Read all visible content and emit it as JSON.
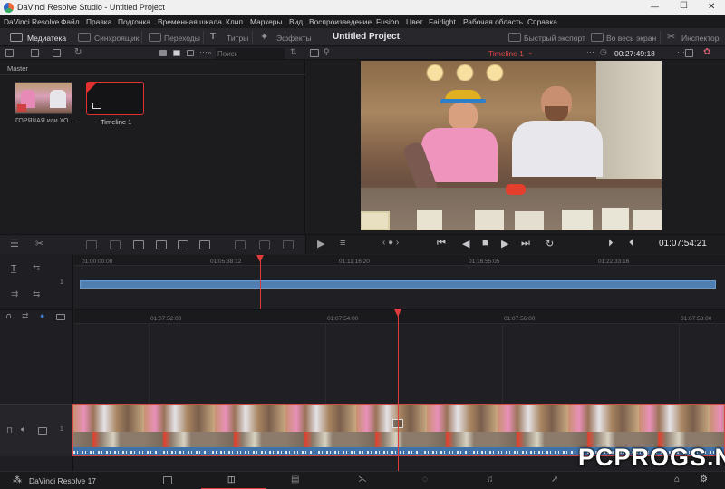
{
  "window": {
    "title": "DaVinci Resolve Studio - Untitled Project",
    "minimize": "—",
    "maximize": "☐",
    "close": "✕"
  },
  "menu": [
    "DaVinci Resolve",
    "Файл",
    "Правка",
    "Подгонка",
    "Временная шкала",
    "Клип",
    "Маркеры",
    "Вид",
    "Воспроизведение",
    "Fusion",
    "Цвет",
    "Fairlight",
    "Рабочая область",
    "Справка"
  ],
  "toolbar": {
    "media": "Медиатека",
    "sync": "Синхроящик",
    "transitions": "Переходы",
    "titles": "Титры",
    "effects": "Эффекты",
    "project": "Untitled Project",
    "quick_export": "Быстрый экспорт",
    "fullscreen": "Во весь экран",
    "inspector": "Инспектор"
  },
  "media_pool": {
    "search_placeholder": "Поиск",
    "bin": "Master",
    "clips": [
      {
        "label": "ГОРЯЧАЯ или ХО..."
      },
      {
        "label": "Timeline 1"
      }
    ]
  },
  "viewer": {
    "timeline_name": "Timeline 1",
    "timecode_top": "00:27:49:18",
    "timecode": "01:07:54:21"
  },
  "mini_ruler": [
    "01:00:00:00",
    "01:05:38:12",
    "01:11:16:20",
    "01:16:55:05",
    "01:22:33:16"
  ],
  "ruler": [
    "01:07:52:00",
    "01:07:54:00",
    "01:07:56:00",
    "01:07:58:00"
  ],
  "track": {
    "number": "1"
  },
  "footer": {
    "product": "DaVinci Resolve 17"
  },
  "watermark": "PCPROGS.NET"
}
